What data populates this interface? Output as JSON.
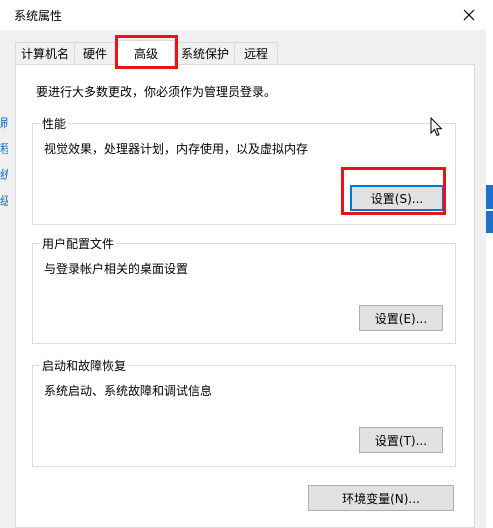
{
  "window": {
    "title": "系统属性"
  },
  "tabs": [
    {
      "label": "计算机名",
      "active": false
    },
    {
      "label": "硬件",
      "active": false
    },
    {
      "label": "高级",
      "active": true
    },
    {
      "label": "系统保护",
      "active": false
    },
    {
      "label": "远程",
      "active": false
    }
  ],
  "advanced": {
    "admin_note": "要进行大多数更改，你必须作为管理员登录。",
    "performance": {
      "title": "性能",
      "description": "视觉效果，处理器计划，内存使用，以及虚拟内存",
      "button_label": "设置(S)..."
    },
    "user_profiles": {
      "title": "用户配置文件",
      "description": "与登录帐户相关的桌面设置",
      "button_label": "设置(E)..."
    },
    "startup_recovery": {
      "title": "启动和故障恢复",
      "description": "系统启动、系统故障和调试信息",
      "button_label": "设置(T)..."
    },
    "env_vars_label": "环境变量(N)..."
  },
  "background_fragments": {
    "left": [
      "刷",
      "程",
      "统",
      "级"
    ]
  },
  "colors": {
    "highlight": "#e8141a",
    "focus_border": "#0078d7",
    "background_accent": "#1a73c9"
  }
}
